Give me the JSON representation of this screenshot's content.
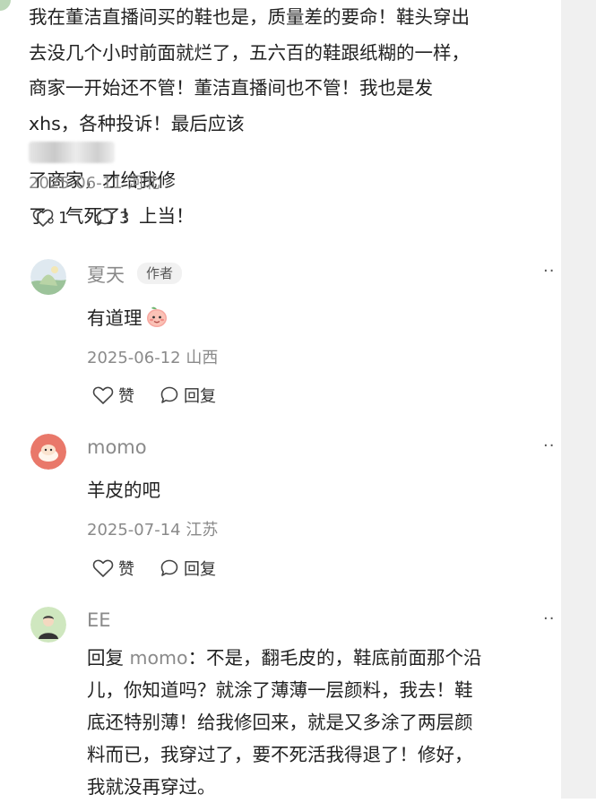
{
  "post": {
    "text_lines": [
      "我在董洁直播间买的鞋也是，质量差的要命！鞋头穿出",
      "去没几个小时前面就烂了，五六百的鞋跟纸糊的一样，",
      "商家一开始还不管！董洁直播间也不管！我也是发",
      "xhs，各种投诉！最后应该",
      "了商家，才给我修",
      "了。气死了！上当！"
    ],
    "date_location": "2025-06-11 河北",
    "likes": "1",
    "comments": "3"
  },
  "replies": [
    {
      "username": "夏天",
      "badge": "作者",
      "text": "有道理",
      "emoji": "peach-emoji",
      "date_location": "2025-06-12 山西",
      "like_label": "赞",
      "reply_label": "回复",
      "more": "··"
    },
    {
      "username": "momo",
      "text": "羊皮的吧",
      "date_location": "2025-07-14 江苏",
      "like_label": "赞",
      "reply_label": "回复",
      "more": "··"
    },
    {
      "username": "EE",
      "reply_prefix": "回复",
      "reply_to": "momo",
      "text_lines": [
        "：不是，翻毛皮的，鞋底前面那个沿",
        "儿，你知道吗？就涂了薄薄一层颜料，我去！鞋",
        "底还特别薄！给我修回来，就是又多涂了两层颜",
        "料而已，我穿过了，要不死活我得退了！修好，",
        "我就没再穿过。"
      ],
      "more": "··"
    }
  ],
  "colors": {
    "text": "#222222",
    "meta": "#8a8a8a",
    "badge_bg": "#f1f1f1",
    "scroll_strip": "#f0f0f0"
  }
}
